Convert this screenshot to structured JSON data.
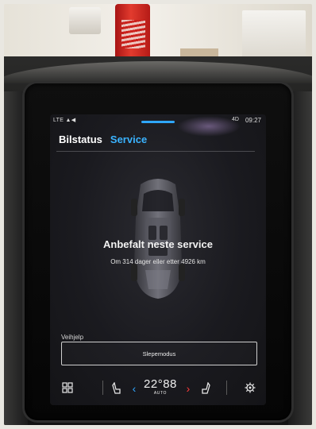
{
  "status_bar": {
    "network": "LTE",
    "indicator": "4D",
    "clock": "09:27"
  },
  "tabs": [
    {
      "label": "Bilstatus",
      "active": false
    },
    {
      "label": "Service",
      "active": true
    }
  ],
  "service": {
    "title": "Anbefalt neste service",
    "subtitle": "Om 314 dager eller etter 4926 km"
  },
  "roadside": {
    "section_label": "Veihjelp",
    "tow_button_label": "Slepemodus"
  },
  "climate": {
    "temperature": "22",
    "temperature_unit": "°",
    "fan_level": "88",
    "mode": "AUTO"
  },
  "icons": {
    "apps": "grid-icon",
    "seat_left": "seat-heat-icon",
    "seat_right": "seat-heat-icon",
    "settings": "gear-icon"
  },
  "colors": {
    "accent_blue": "#3ab3ff",
    "accent_red": "#ff3b3b"
  }
}
